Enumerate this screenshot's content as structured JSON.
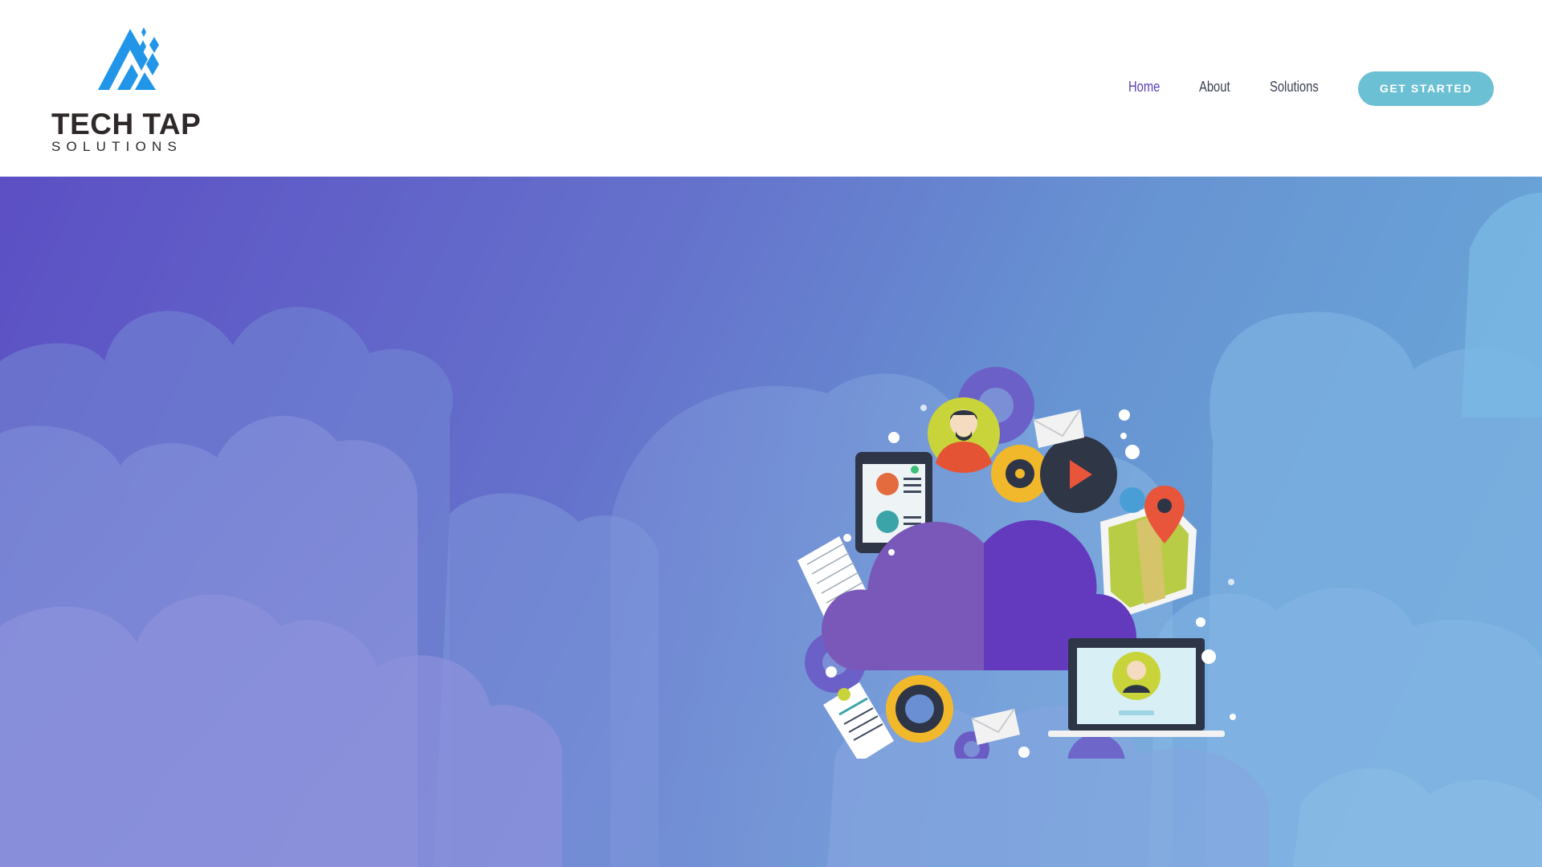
{
  "brand": {
    "name": "TECH TAP",
    "tagline": "SOLUTIONS",
    "logo_icon": "tech-tap-mountain-mark",
    "logo_color": "#2196e8"
  },
  "nav": {
    "items": [
      {
        "label": "Home",
        "active": true
      },
      {
        "label": "About",
        "active": false
      },
      {
        "label": "Solutions",
        "active": false
      }
    ],
    "cta_label": "GET STARTED"
  },
  "colors": {
    "nav_active": "#5b3fb5",
    "nav_text": "#3d4354",
    "cta_background": "#6cc0d4",
    "hero_gradient_start": "#5c4fc4",
    "hero_gradient_end": "#6aaedb",
    "cloud_purple": "#6a3fc0"
  },
  "hero": {
    "illustration": "cloud-computing-icon-cluster",
    "icons": [
      "user-avatar-icon",
      "gear-icon",
      "envelope-icon",
      "play-icon",
      "map-pin-icon",
      "map-icon",
      "tablet-icon",
      "notepad-icon",
      "document-icon",
      "laptop-icon",
      "cloud-icon"
    ]
  }
}
